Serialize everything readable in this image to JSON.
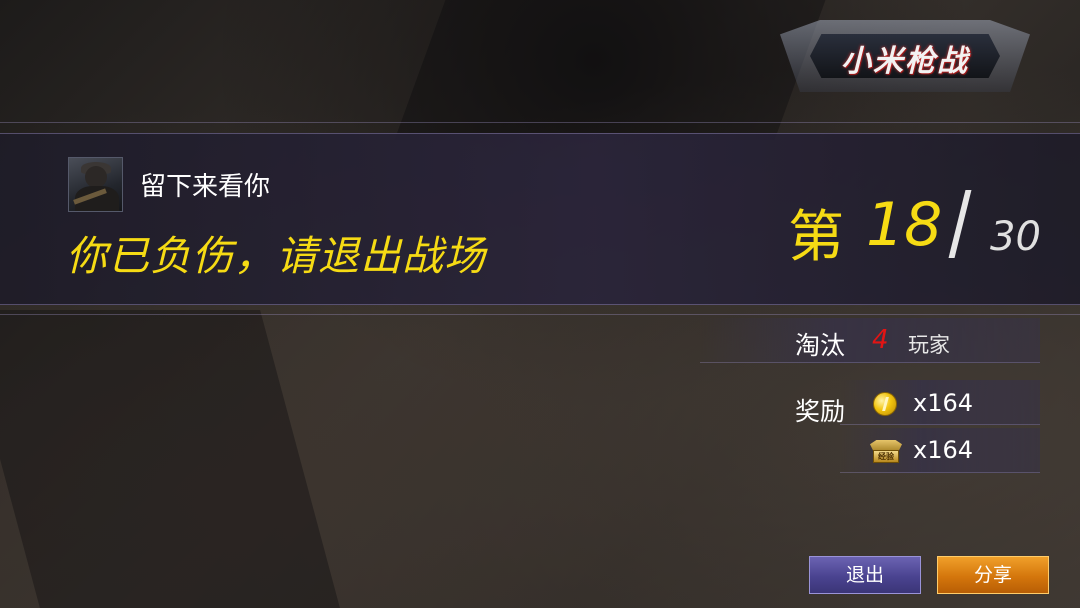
{
  "game": {
    "logo_text": "小米枪战"
  },
  "player": {
    "name": "留下来看你",
    "avatar_icon": "soldier-avatar-icon"
  },
  "result": {
    "message": "你已负伤，请退出战场",
    "rank_prefix": "第",
    "rank": "18",
    "rank_total": "30"
  },
  "stats": {
    "eliminated_label": "淘汰",
    "eliminated_count": "4",
    "eliminated_unit": "玩家",
    "reward_label": "奖励",
    "rewards": [
      {
        "icon": "gold-coin-icon",
        "quantity": "x164"
      },
      {
        "icon": "experience-badge-icon",
        "badge_text": "经验",
        "quantity": "x164"
      }
    ]
  },
  "buttons": {
    "exit_label": "退出",
    "share_label": "分享"
  },
  "colors": {
    "accent_yellow": "#f6db14",
    "kill_red": "#e21414",
    "exit_button": "#4a4390",
    "share_button": "#d4760c"
  }
}
